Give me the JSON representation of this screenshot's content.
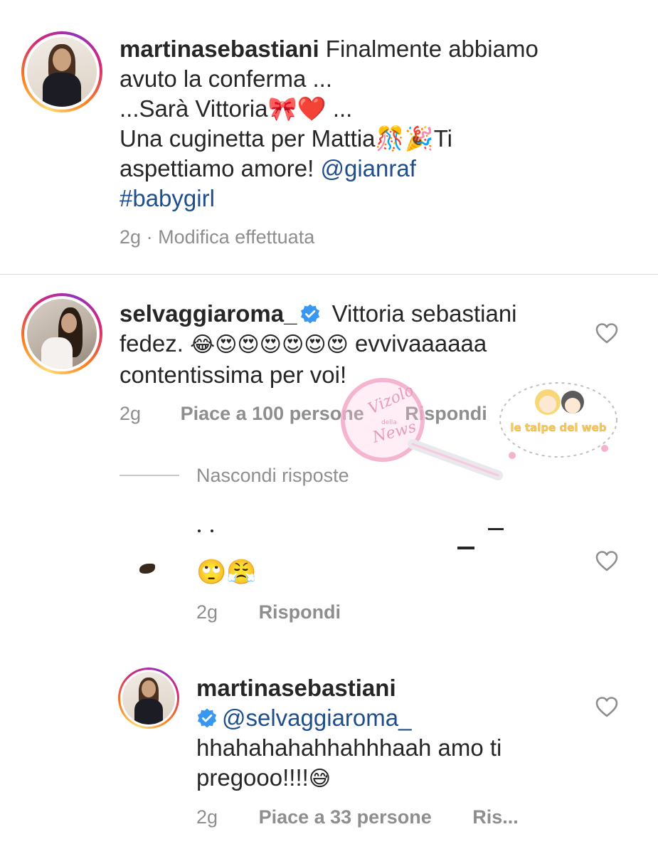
{
  "post_caption": {
    "username": "martinasebastiani",
    "line1": "Finalmente abbiamo",
    "line2": "avuto la conferma ...",
    "line3": "...Sarà Vittoria🎀❤️ ...",
    "line4": "Una cuginetta per Mattia🎊🎉Ti",
    "line5_text": "aspettiamo amore! ",
    "mention": "@gianraf",
    "hashtag": "#babygirl",
    "time": "2g",
    "separator": "·",
    "edited": "Modifica effettuata"
  },
  "comment_main": {
    "username": "selvaggiaroma_",
    "text_line1": "Vittoria sebastiani",
    "text_line2_start": "fedez. ",
    "emojis": "😂😍😍😍😍😍😍",
    "text_line2_end": " evvivaaaaaa",
    "text_line3": "contentissima per voi!",
    "time": "2g",
    "likes": "Piace a 100 persone",
    "reply": "Rispondi"
  },
  "replies_toggle": {
    "label": "Nascondi risposte"
  },
  "reply_1": {
    "emojis": "🙄😤",
    "time": "2g",
    "reply": "Rispondi"
  },
  "reply_2": {
    "username": "martinasebastiani",
    "mention": "@selvaggiaroma_",
    "text_line1": "hhahahahahhahhhaah amo ti",
    "text_line2": "pregooo!!!!",
    "emoji": "😅",
    "time": "2g",
    "likes": "Piace a 33 persone",
    "reply": "Ris..."
  },
  "watermarks": {
    "left": {
      "line1": "Vizolo",
      "line2": "della",
      "line3": "News"
    },
    "right": "le talpe del web"
  },
  "colors": {
    "link": "#1e4e8c",
    "meta": "#8e8e8e",
    "verified": "#3897f0",
    "divider": "#dbdbdb"
  },
  "icons": [
    "heart-outline-icon",
    "verified-badge-icon"
  ]
}
